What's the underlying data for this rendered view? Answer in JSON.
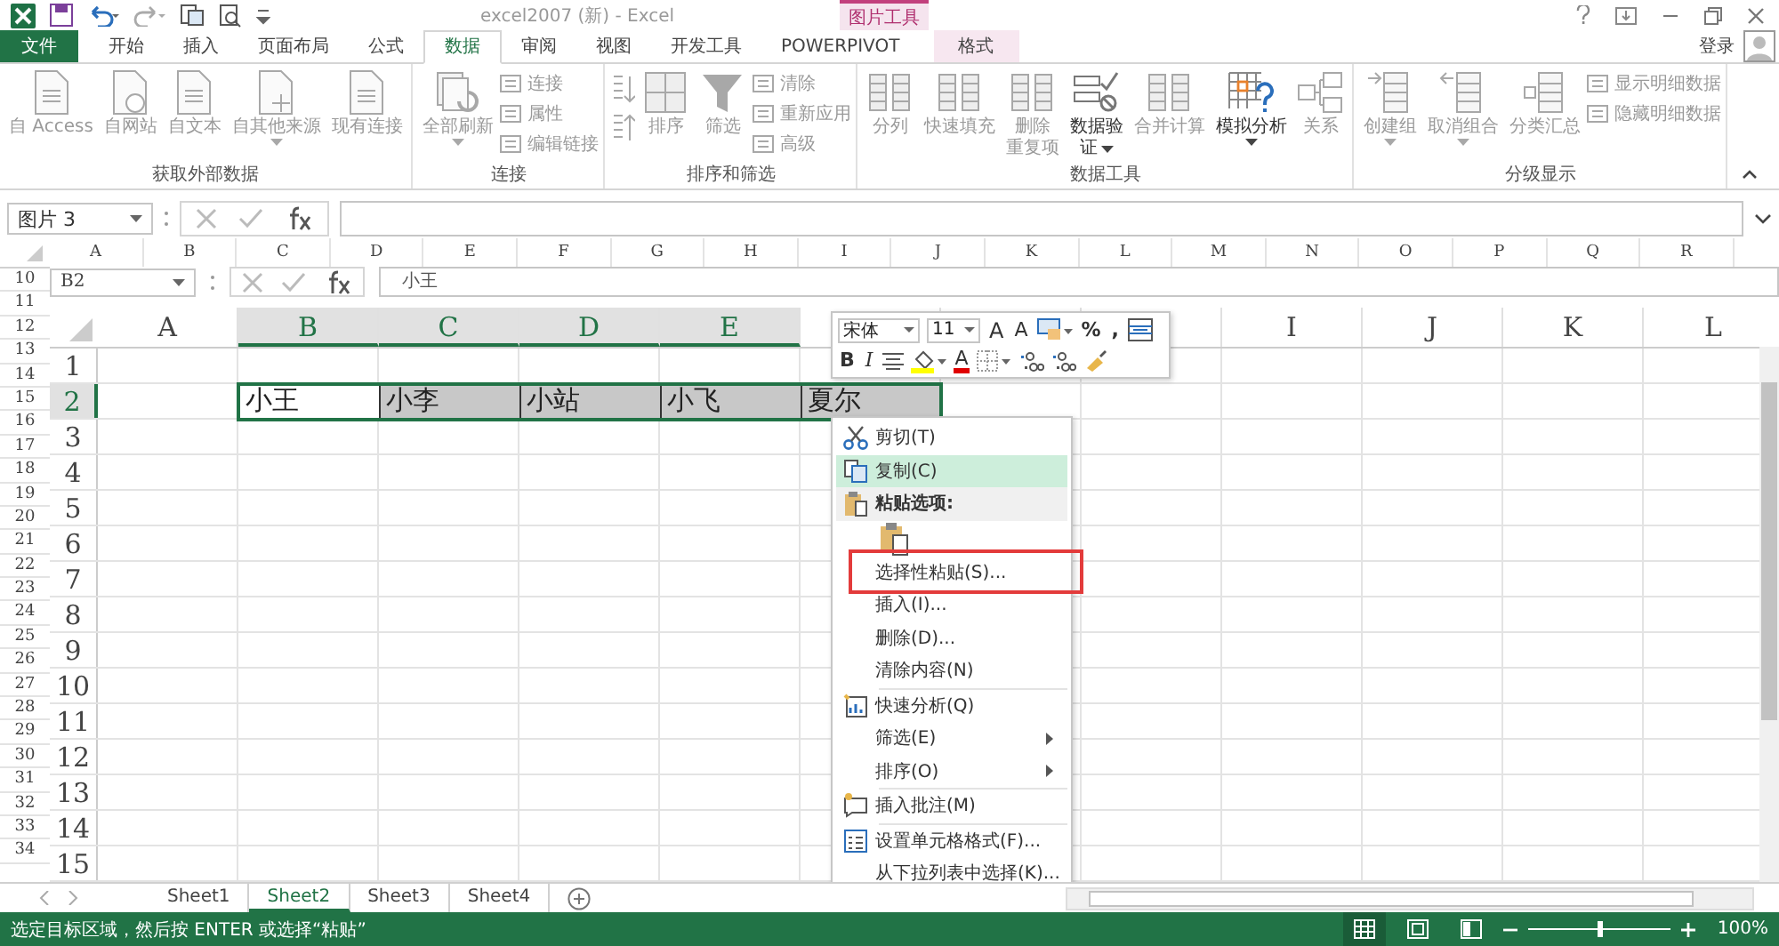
{
  "title_bar": {
    "title": "excel2007 (新) - Excel",
    "context_group": "图片工具"
  },
  "ribbon_tabs": [
    {
      "label": "文件",
      "kind": "file",
      "selected": false
    },
    {
      "label": "开始",
      "kind": "tab",
      "selected": false
    },
    {
      "label": "插入",
      "kind": "tab",
      "selected": false
    },
    {
      "label": "页面布局",
      "kind": "tab",
      "selected": false
    },
    {
      "label": "公式",
      "kind": "tab",
      "selected": false
    },
    {
      "label": "数据",
      "kind": "tab",
      "selected": true
    },
    {
      "label": "审阅",
      "kind": "tab",
      "selected": false
    },
    {
      "label": "视图",
      "kind": "tab",
      "selected": false
    },
    {
      "label": "开发工具",
      "kind": "tab",
      "selected": false
    },
    {
      "label": "POWERPIVOT",
      "kind": "tab",
      "selected": false
    },
    {
      "label": "格式",
      "kind": "context",
      "selected": false
    }
  ],
  "account": {
    "label": "登录"
  },
  "ribbon_groups": [
    {
      "label": "获取外部数据",
      "buttons": [
        {
          "kind": "large",
          "lines": [
            "自 Access"
          ],
          "disabled": true
        },
        {
          "kind": "large",
          "lines": [
            "自网站"
          ],
          "disabled": true
        },
        {
          "kind": "large",
          "lines": [
            "自文本"
          ],
          "disabled": true
        },
        {
          "kind": "large",
          "lines": [
            "自其他来源"
          ],
          "disabled": true,
          "dropdown": true
        },
        {
          "kind": "large",
          "lines": [
            "现有连接"
          ],
          "disabled": true
        }
      ]
    },
    {
      "label": "连接",
      "buttons": [
        {
          "kind": "large",
          "lines": [
            "全部刷新"
          ],
          "disabled": true,
          "dropdown": true
        },
        {
          "kind": "small_stack",
          "items": [
            {
              "label": "连接",
              "disabled": true
            },
            {
              "label": "属性",
              "disabled": true
            },
            {
              "label": "编辑链接",
              "disabled": true
            }
          ]
        }
      ]
    },
    {
      "label": "排序和筛选",
      "buttons": [
        {
          "kind": "sort_pair",
          "disabled": true
        },
        {
          "kind": "large",
          "lines": [
            "排序"
          ],
          "disabled": true
        },
        {
          "kind": "large",
          "lines": [
            "筛选"
          ],
          "disabled": true
        },
        {
          "kind": "small_stack",
          "items": [
            {
              "label": "清除",
              "disabled": true
            },
            {
              "label": "重新应用",
              "disabled": true
            },
            {
              "label": "高级",
              "disabled": true
            }
          ]
        }
      ]
    },
    {
      "label": "数据工具",
      "buttons": [
        {
          "kind": "large",
          "lines": [
            "分列"
          ],
          "disabled": true
        },
        {
          "kind": "large",
          "lines": [
            "快速填充"
          ],
          "disabled": true
        },
        {
          "kind": "large",
          "lines": [
            "删除",
            "重复项"
          ],
          "disabled": true
        },
        {
          "kind": "large",
          "lines": [
            "数据验",
            "证"
          ],
          "disabled": false,
          "dropdown": true
        },
        {
          "kind": "large",
          "lines": [
            "合并计算"
          ],
          "disabled": true
        },
        {
          "kind": "large",
          "lines": [
            "模拟分析"
          ],
          "disabled": false,
          "dropdown": true
        },
        {
          "kind": "large",
          "lines": [
            "关系"
          ],
          "disabled": true
        }
      ]
    },
    {
      "label": "分级显示",
      "buttons": [
        {
          "kind": "large",
          "lines": [
            "创建组"
          ],
          "disabled": true,
          "dropdown": true
        },
        {
          "kind": "large",
          "lines": [
            "取消组合"
          ],
          "disabled": true,
          "dropdown": true
        },
        {
          "kind": "large",
          "lines": [
            "分类汇总"
          ],
          "disabled": true
        },
        {
          "kind": "small_stack",
          "items": [
            {
              "label": "显示明细数据",
              "disabled": true
            },
            {
              "label": "隐藏明细数据",
              "disabled": true
            }
          ]
        }
      ]
    }
  ],
  "formula_bar": {
    "name_box": "图片 3"
  },
  "sheet": {
    "columns": [
      "A",
      "B",
      "C",
      "D",
      "E",
      "F",
      "G",
      "H",
      "I",
      "J",
      "K",
      "L",
      "M",
      "N",
      "O",
      "P",
      "Q",
      "R"
    ],
    "rows": [
      "10",
      "11",
      "12",
      "13",
      "14",
      "15",
      "16",
      "17",
      "18",
      "19",
      "20",
      "21",
      "22",
      "23",
      "24",
      "25",
      "26",
      "27",
      "28",
      "29",
      "30",
      "31",
      "32",
      "33",
      "34"
    ]
  },
  "pasted_screenshot": {
    "name_box": "B2",
    "formula": "小王",
    "columns_left": [
      {
        "label": "A",
        "selected": false
      },
      {
        "label": "B",
        "selected": true
      },
      {
        "label": "C",
        "selected": true
      },
      {
        "label": "D",
        "selected": true
      },
      {
        "label": "E",
        "selected": true
      }
    ],
    "columns_right": [
      {
        "label": "I",
        "selected": false
      },
      {
        "label": "J",
        "selected": false
      },
      {
        "label": "K",
        "selected": false
      },
      {
        "label": "L",
        "selected": false
      }
    ],
    "rows": [
      {
        "label": "1",
        "selected": false
      },
      {
        "label": "2",
        "selected": true
      },
      {
        "label": "3",
        "selected": false
      },
      {
        "label": "4",
        "selected": false
      },
      {
        "label": "5",
        "selected": false
      },
      {
        "label": "6",
        "selected": false
      },
      {
        "label": "7",
        "selected": false
      },
      {
        "label": "8",
        "selected": false
      },
      {
        "label": "9",
        "selected": false
      },
      {
        "label": "10",
        "selected": false
      },
      {
        "label": "11",
        "selected": false
      },
      {
        "label": "12",
        "selected": false
      },
      {
        "label": "13",
        "selected": false
      },
      {
        "label": "14",
        "selected": false
      },
      {
        "label": "15",
        "selected": false
      }
    ],
    "selected_cells": [
      {
        "text": "小王",
        "active": true
      },
      {
        "text": "小李",
        "active": false
      },
      {
        "text": "小站",
        "active": false
      },
      {
        "text": "小飞",
        "active": false
      },
      {
        "text": "夏尔",
        "active": false
      }
    ],
    "mini_toolbar": {
      "row_1": [
        {
          "kind": "font",
          "label": "宋体"
        },
        {
          "kind": "size",
          "label": "11"
        },
        {
          "kind": "grow",
          "label": "A"
        },
        {
          "kind": "shrink",
          "label": "A"
        },
        {
          "kind": "style"
        },
        {
          "kind": "symbol",
          "label": "%"
        },
        {
          "kind": "symbol",
          "label": ","
        },
        {
          "kind": "merge"
        }
      ],
      "row_2": [
        {
          "kind": "bold",
          "label": "B"
        },
        {
          "kind": "italic",
          "label": "I"
        },
        {
          "kind": "align"
        },
        {
          "kind": "fill"
        },
        {
          "kind": "font_color",
          "label": "A"
        },
        {
          "kind": "border"
        },
        {
          "kind": "decimal"
        },
        {
          "kind": "decimal"
        },
        {
          "kind": "painter"
        }
      ]
    },
    "context_menu": [
      {
        "kind": "cut",
        "label": "剪切(T)"
      },
      {
        "kind": "copy",
        "label": "复制(C)",
        "highlighted": true
      },
      {
        "kind": "paste_header",
        "label": "粘贴选项:"
      },
      {
        "kind": "paste_button"
      },
      {
        "kind": "item",
        "label": "选择性粘贴(S)..."
      },
      {
        "kind": "item",
        "label": "插入(I)..."
      },
      {
        "kind": "item",
        "label": "删除(D)..."
      },
      {
        "kind": "item",
        "label": "清除内容(N)"
      },
      {
        "kind": "quick",
        "label": "快速分析(Q)",
        "separator_before": true
      },
      {
        "kind": "item",
        "label": "筛选(E)",
        "submenu": true
      },
      {
        "kind": "item",
        "label": "排序(O)",
        "submenu": true
      },
      {
        "kind": "comment",
        "label": "插入批注(M)",
        "separator_before": true
      },
      {
        "kind": "format",
        "label": "设置单元格格式(F)...",
        "separator_before": true
      },
      {
        "kind": "item",
        "label": "从下拉列表中选择(K)..."
      }
    ]
  },
  "sheet_tabs": [
    {
      "label": "Sheet1",
      "selected": false
    },
    {
      "label": "Sheet2",
      "selected": true
    },
    {
      "label": "Sheet3",
      "selected": false
    },
    {
      "label": "Sheet4",
      "selected": false
    }
  ],
  "status_bar": {
    "message": "选定目标区域，然后按 ENTER 或选择“粘贴”",
    "views": [
      {
        "kind": "normal",
        "selected": true
      },
      {
        "kind": "page_layout",
        "selected": false
      },
      {
        "kind": "page_break",
        "selected": false
      }
    ],
    "zoom": {
      "level": 0.5,
      "label": "100%"
    }
  }
}
